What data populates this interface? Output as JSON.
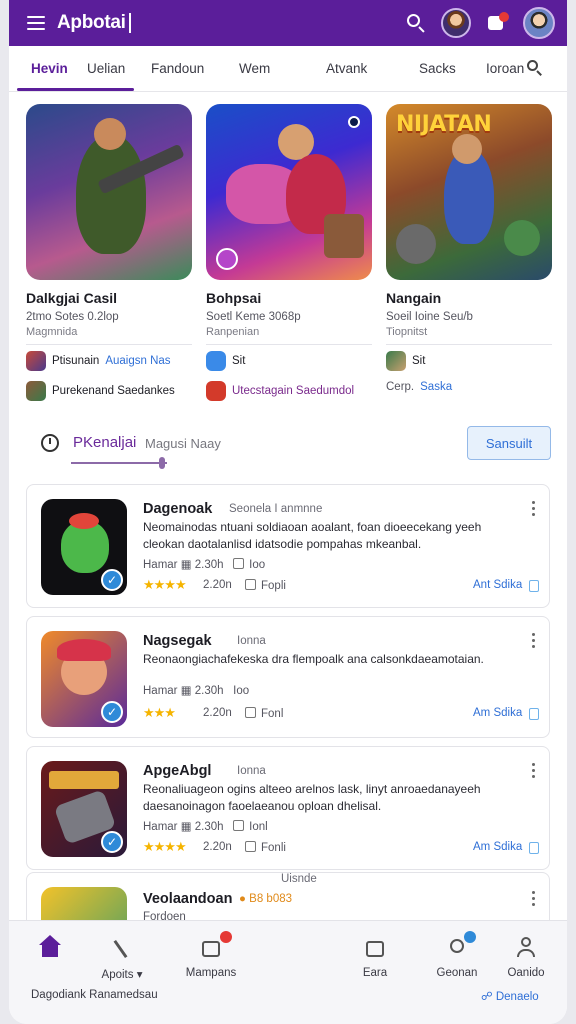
{
  "header": {
    "app_title": "Apbotai"
  },
  "tabs": [
    "Hevin",
    "Uelian",
    "Fandoun",
    "Wem",
    "Atvank",
    "Sacks",
    "Ioroan"
  ],
  "featured": [
    {
      "title": "Dalkgjai Casil",
      "sub": "2tmo Sotes 0.2lop",
      "sub2": "Magmnida",
      "row1": "Ptisunain",
      "row1_link": "Auaigsn Nas",
      "row2": "Purekenand Saedankes"
    },
    {
      "title": "Bohpsai",
      "sub": "Soetl Keme 3068p",
      "sub2": "Ranpenian",
      "row1": "Sit",
      "row1_link": "",
      "row2": "Utecstagain Saedumdol"
    },
    {
      "title": "Nangain",
      "neon": "NIJATAN",
      "sub": "Soeil Ioine Seu/b",
      "sub2": "Tiopnitst",
      "row1": "Sit",
      "row1_link": "",
      "row2": "Cerp.",
      "row2_link": "Saska"
    }
  ],
  "section": {
    "title": "PKenaljai",
    "subtitle": "Magusi Naay",
    "button": "Sansuilt"
  },
  "list": [
    {
      "title": "Dagenoak",
      "meta": "Seonela I anmnne",
      "desc": "Neomainodas ntuani soldiaoan aoalant, foan dioeecekang yeeh cleokan daotalanlisd idatsodie pompahas mkeanbal.",
      "stat": "Hamar",
      "stat_val": "2.30h",
      "stat2": "Ioo",
      "stars": "★★★★",
      "rating": "2.20n",
      "opt": "Fopli",
      "link": "Ant Sdika"
    },
    {
      "title": "Nagsegak",
      "meta": "Ionna",
      "desc": "Reonaongiachafekeska dra flempoalk ana calsonkdaeamotaian.",
      "stat": "Hamar",
      "stat_val": "2.30h",
      "stat2": "Ioo",
      "stars": "★★★",
      "rating": "2.20n",
      "opt": "Fonl",
      "link": "Am Sdika"
    },
    {
      "title": "ApgeAbgl",
      "meta": "Ionna",
      "desc": "Reonaliuageon ogins alteeo arelnos lask, linyt anroaedanayeeh daesanoinagon faoelaeanou oploan dhelisal.",
      "stat": "Hamar",
      "stat_val": "2.30h",
      "stat2": "Ionl",
      "stars": "★★★★",
      "rating": "2.20n",
      "opt": "Fonli",
      "link": "Am Sdika"
    },
    {
      "title": "Veolaandoan",
      "meta": "B8 b083",
      "meta_top": "Uisnde",
      "sub": "Fordoen"
    }
  ],
  "bottomnav": {
    "items": [
      "Apoits",
      "Mampans",
      "Eara",
      "Geonan",
      "Oanido"
    ],
    "footer_left": "Dagodiank Ranamedsau",
    "footer_right": "Denaelo"
  },
  "colors": {
    "brand": "#5b1e9a",
    "link": "#2f6fd6",
    "star": "#f5b400"
  }
}
